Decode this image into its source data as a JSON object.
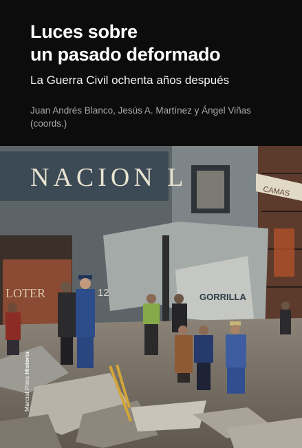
{
  "book": {
    "title_line1": "Luces sobre",
    "title_line2": "un pasado deformado",
    "subtitle": "La Guerra Civil ochenta años después",
    "authors_line1": "Juan Andrés Blanco, Jesús A. Martínez y Ángel Viñas",
    "authors_line2": "(coords.)"
  },
  "photo": {
    "sign_nacion": "NACION L",
    "sign_loteria": "LOTER",
    "sign_number": "12",
    "sign_gorrilla": "GORRILLA",
    "sign_banner": "CAMAS"
  },
  "spine": {
    "publisher": "Marcial Pons",
    "collection": "Historia"
  },
  "colors": {
    "header_bg": "#0c0c0c",
    "title": "#ffffff",
    "authors": "#a9a9a9"
  }
}
